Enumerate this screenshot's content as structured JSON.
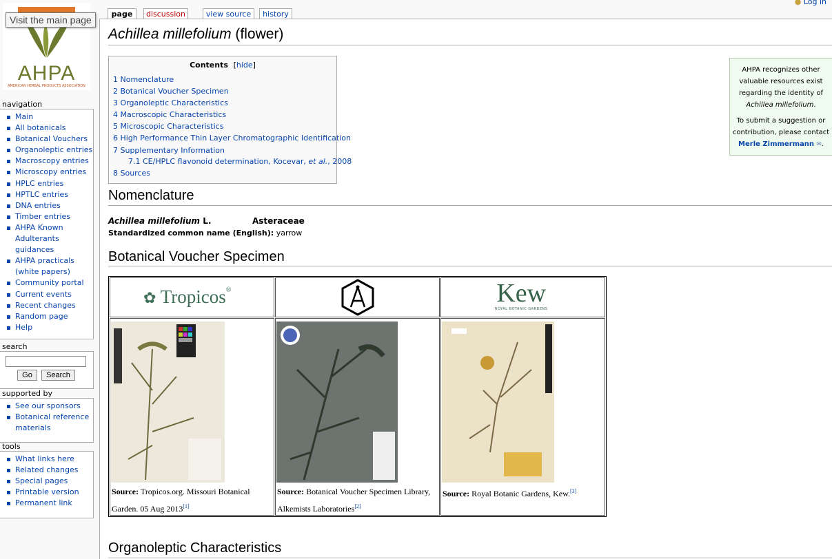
{
  "logo": {
    "text": "AHPA",
    "tagline": "AMERICAN HERBAL PRODUCTS ASSOCIATION"
  },
  "tooltip": "Visit the main page",
  "user": {
    "login": "Log in"
  },
  "tabs": [
    {
      "label": "page"
    },
    {
      "label": "discussion"
    },
    {
      "label": "view source"
    },
    {
      "label": "history"
    }
  ],
  "navigation": {
    "heading": "navigation",
    "items": [
      "Main",
      "All botanicals",
      "Botanical Vouchers",
      "Organoleptic entries",
      "Macroscopy entries",
      "Microscopy entries",
      "HPLC entries",
      "HPTLC entries",
      "DNA entries",
      "Timber entries",
      "AHPA Known",
      "Adulterants",
      "guidances",
      "AHPA practicals",
      "(white papers)",
      "Community portal",
      "Current events",
      "Recent changes",
      "Random page",
      "Help"
    ]
  },
  "search": {
    "heading": "search",
    "go": "Go",
    "search": "Search",
    "value": ""
  },
  "supported": {
    "heading": "supported by",
    "items": [
      "See our sponsors",
      "Botanical reference",
      "materials"
    ]
  },
  "tools": {
    "heading": "tools",
    "items": [
      "What links here",
      "Related changes",
      "Special pages",
      "Printable version",
      "Permanent link"
    ]
  },
  "page": {
    "title_italic": "Achillea millefolium",
    "title_rest": "(flower)",
    "toc": {
      "title": "Contents",
      "hide": "[hide]",
      "items": [
        "1 Nomenclature",
        "2 Botanical Voucher Specimen",
        "3 Organoleptic Characteristics",
        "4 Macroscopic Characteristics",
        "5 Microscopic Characteristics",
        "6 High Performance Thin Layer Chromatographic Identification",
        "7 Supplementary Information"
      ],
      "sub_prefix": "7.1 CE/HPLC flavonoid determination, Kocevar, ",
      "sub_etal": "et al.",
      "sub_suffix": ", 2008",
      "last": "8 Sources"
    },
    "aside": {
      "line1": "AHPA recognizes other",
      "line2": "valuable resources exist",
      "line3": "regarding the identity of",
      "line4": "Achillea millefolium",
      "line5": "To submit a suggestion or",
      "line6": "contribution, please contact",
      "contact": "Merle Zimmermann"
    },
    "nomenclature": {
      "heading": "Nomenclature",
      "species": "Achillea millefolium",
      "author": "L.",
      "family": "Asteraceae",
      "common_label": "Standardized common name (English):",
      "common_value": "yarrow"
    },
    "voucher": {
      "heading": "Botanical Voucher Specimen",
      "logos": {
        "tropicos": "Tropicos",
        "kew": "Kew",
        "kew_sub": "ROYAL BOTANIC GARDENS"
      },
      "captions": [
        {
          "bold": "Source:",
          "text": "Tropicos.org. Missouri Botanical Garden. 05 Aug 2013",
          "ref": "[1]"
        },
        {
          "bold": "Source:",
          "text": "Botanical Voucher Specimen Library, Alkemists Laboratories",
          "ref": "[2]"
        },
        {
          "bold": "Source:",
          "text": "Royal Botanic Gardens, Kew.",
          "ref": "[3]"
        }
      ]
    },
    "organoleptic": {
      "heading": "Organoleptic Characteristics"
    }
  }
}
